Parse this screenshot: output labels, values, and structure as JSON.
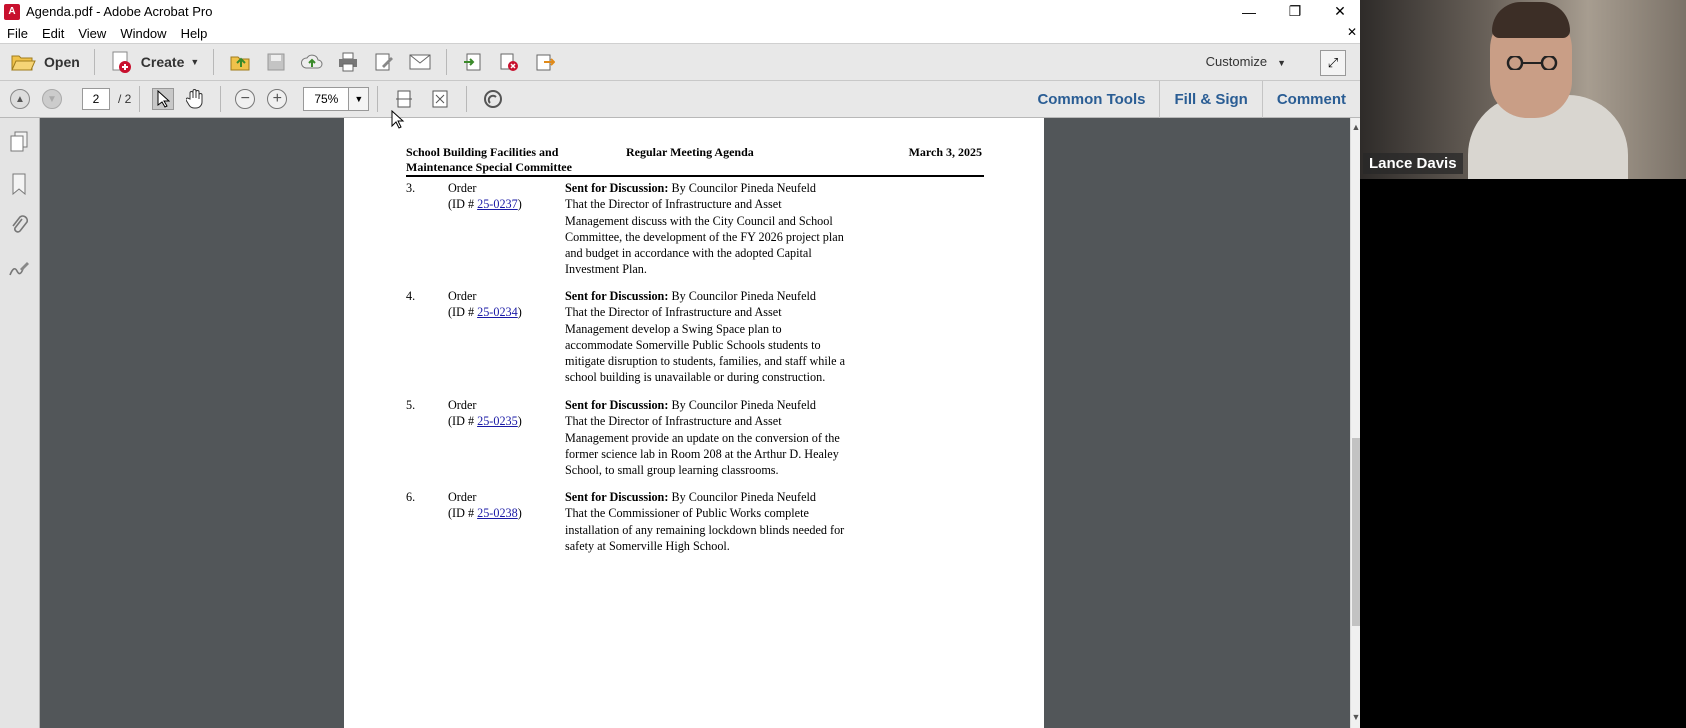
{
  "window": {
    "title": "Agenda.pdf - Adobe Acrobat Pro",
    "app_icon_label": "A"
  },
  "menu": [
    "File",
    "Edit",
    "View",
    "Window",
    "Help"
  ],
  "toolbar": {
    "open_label": "Open",
    "create_label": "Create",
    "customize_label": "Customize"
  },
  "nav": {
    "current_page": "2",
    "total_pages": "/ 2",
    "zoom": "75%"
  },
  "right_links": {
    "common_tools": "Common Tools",
    "fill_sign": "Fill & Sign",
    "comment": "Comment"
  },
  "document": {
    "header_left_line1": "School Building Facilities and",
    "header_left_line2": "Maintenance Special Committee",
    "header_center": "Regular Meeting Agenda",
    "header_right": "March 3, 2025",
    "items": [
      {
        "num": "3.",
        "type": "Order",
        "id_prefix": "(ID # ",
        "id": "25-0237",
        "id_suffix": ")",
        "bold": "Sent for Discussion:",
        "by": " By Councilor Pineda Neufeld",
        "lines": [
          "That the Director of Infrastructure and Asset",
          "Management discuss with the City Council and School",
          "Committee, the development of the FY 2026 project plan",
          "and budget in accordance with the adopted Capital",
          "Investment Plan."
        ]
      },
      {
        "num": "4.",
        "type": "Order",
        "id_prefix": "(ID # ",
        "id": "25-0234",
        "id_suffix": ")",
        "bold": "Sent for Discussion:",
        "by": " By Councilor Pineda Neufeld",
        "lines": [
          "That the Director of Infrastructure and Asset",
          "Management develop a Swing Space plan to",
          "accommodate Somerville Public Schools students to",
          "mitigate disruption to students, families, and staff while a",
          "school building is unavailable or during construction."
        ]
      },
      {
        "num": "5.",
        "type": "Order",
        "id_prefix": "(ID # ",
        "id": "25-0235",
        "id_suffix": ")",
        "bold": "Sent for Discussion:",
        "by": " By Councilor Pineda Neufeld",
        "lines": [
          "That the Director of Infrastructure and Asset",
          "Management provide an update on the conversion of the",
          "former science lab in Room 208 at the Arthur D. Healey",
          "School, to small group learning classrooms."
        ]
      },
      {
        "num": "6.",
        "type": "Order",
        "id_prefix": "(ID # ",
        "id": "25-0238",
        "id_suffix": ")",
        "bold": "Sent for Discussion:",
        "by": " By Councilor Pineda Neufeld",
        "lines": [
          "That the Commissioner of Public Works complete",
          "installation of any remaining lockdown blinds needed for",
          "safety at Somerville High School."
        ]
      }
    ]
  },
  "video": {
    "participant_name": "Lance Davis"
  },
  "colors": {
    "link": "#1a1aa6",
    "right_link": "#2a5d94",
    "doc_background": "#525659"
  }
}
